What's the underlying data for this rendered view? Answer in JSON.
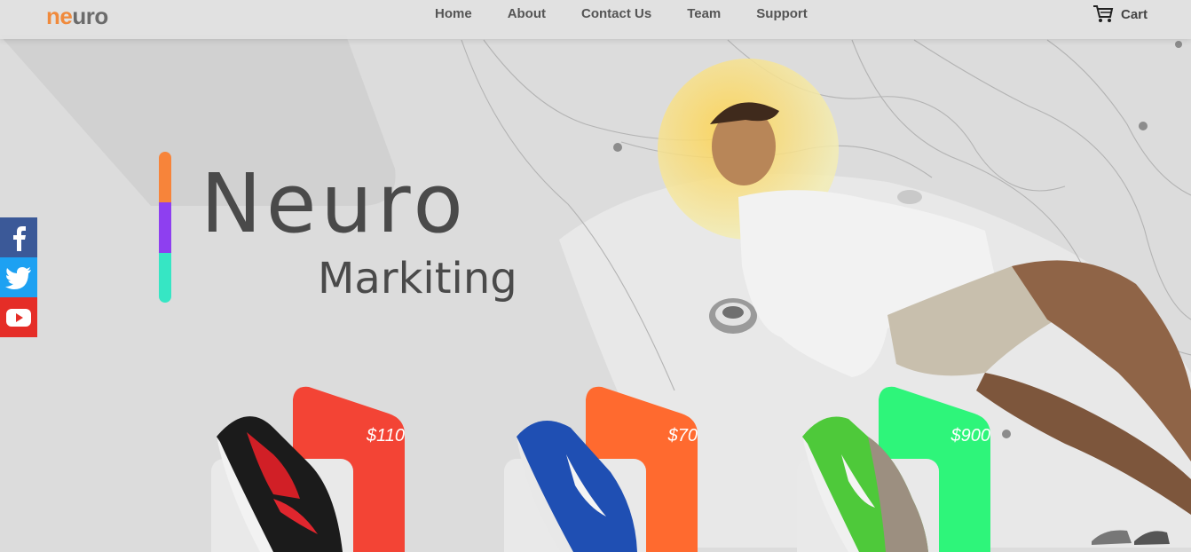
{
  "nav": {
    "logo_part1": "ne",
    "logo_part2": "uro",
    "links": [
      "Home",
      "About",
      "Contact Us",
      "Team",
      "Support"
    ],
    "cart_label": "Cart"
  },
  "hero": {
    "title": "Neuro",
    "subtitle": "Markiting",
    "accent_colors": [
      "#f7843a",
      "#8e3ff0",
      "#36e6c4"
    ]
  },
  "social": [
    {
      "name": "facebook-icon",
      "color": "#3b5998"
    },
    {
      "name": "twitter-icon",
      "color": "#1da1f2"
    },
    {
      "name": "youtube-icon",
      "color": "#e52d27"
    }
  ],
  "products": [
    {
      "price": "$110",
      "color": "#f34435"
    },
    {
      "price": "$70",
      "color": "#ff6a2f"
    },
    {
      "price": "$900",
      "color": "#2ef57a"
    }
  ]
}
